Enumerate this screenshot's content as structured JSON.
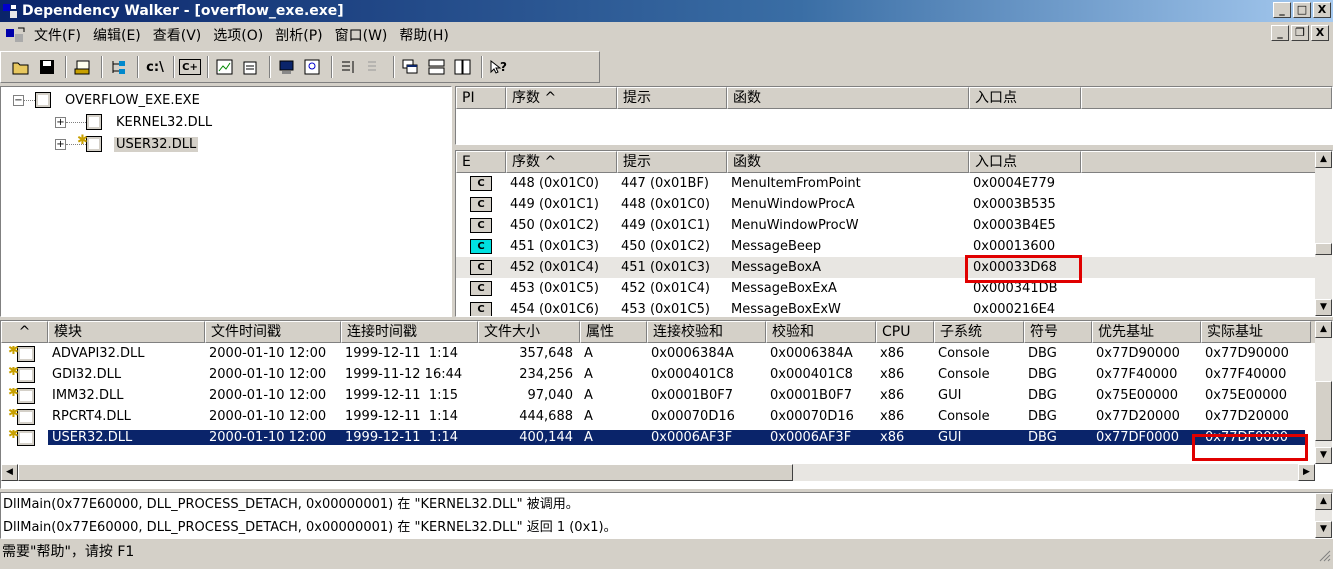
{
  "title": "Dependency Walker - [overflow_exe.exe]",
  "menu": [
    "文件(F)",
    "编辑(E)",
    "查看(V)",
    "选项(O)",
    "剖析(P)",
    "窗口(W)",
    "帮助(H)"
  ],
  "window_buttons": [
    "_",
    "□",
    "X"
  ],
  "mdi_buttons": [
    "_",
    "❐",
    "X"
  ],
  "toolbar": {
    "c_drive": "c:\\",
    "cpp": "C+"
  },
  "tree": [
    {
      "label": "OVERFLOW_EXE.EXE",
      "expander": "−",
      "warn": false
    },
    {
      "label": "KERNEL32.DLL",
      "expander": "+",
      "warn": false
    },
    {
      "label": "USER32.DLL",
      "expander": "+",
      "warn": true
    }
  ],
  "import_headers": [
    "PI",
    "序数 ^",
    "提示",
    "函数",
    "入口点"
  ],
  "export_headers": [
    "E",
    "序数 ^",
    "提示",
    "函数",
    "入口点"
  ],
  "exports": [
    {
      "type": "C",
      "ordinal": "448 (0x01C0)",
      "hint": "447 (0x01BF)",
      "func": "MenuItemFromPoint",
      "entry": "0x0004E779"
    },
    {
      "type": "C",
      "ordinal": "449 (0x01C1)",
      "hint": "448 (0x01C0)",
      "func": "MenuWindowProcA",
      "entry": "0x0003B535"
    },
    {
      "type": "C",
      "ordinal": "450 (0x01C2)",
      "hint": "449 (0x01C1)",
      "func": "MenuWindowProcW",
      "entry": "0x0003B4E5"
    },
    {
      "type": "C",
      "ordinal": "451 (0x01C3)",
      "hint": "450 (0x01C2)",
      "func": "MessageBeep",
      "entry": "0x00013600"
    },
    {
      "type": "C",
      "ordinal": "452 (0x01C4)",
      "hint": "451 (0x01C3)",
      "func": "MessageBoxA",
      "entry": "0x00033D68"
    },
    {
      "type": "C",
      "ordinal": "453 (0x01C5)",
      "hint": "452 (0x01C4)",
      "func": "MessageBoxExA",
      "entry": "0x000341DB"
    },
    {
      "type": "C",
      "ordinal": "454 (0x01C6)",
      "hint": "453 (0x01C5)",
      "func": "MessageBoxExW",
      "entry": "0x000216E4"
    }
  ],
  "module_headers": [
    "^",
    "模块",
    "文件时间戳",
    "连接时间戳",
    "文件大小",
    "属性",
    "连接校验和",
    "校验和",
    "CPU",
    "子系统",
    "符号",
    "优先基址",
    "实际基址"
  ],
  "modules": [
    {
      "name": "ADVAPI32.DLL",
      "filetime": "2000-01-10 12:00",
      "linktime": "1999-12-11  1:14",
      "size": "357,648",
      "attr": "A",
      "linkcs": "0x0006384A",
      "cs": "0x0006384A",
      "cpu": "x86",
      "subsys": "Console",
      "sym": "DBG",
      "pref": "0x77D90000",
      "actual": "0x77D90000"
    },
    {
      "name": "GDI32.DLL",
      "filetime": "2000-01-10 12:00",
      "linktime": "1999-11-12 16:44",
      "size": "234,256",
      "attr": "A",
      "linkcs": "0x000401C8",
      "cs": "0x000401C8",
      "cpu": "x86",
      "subsys": "Console",
      "sym": "DBG",
      "pref": "0x77F40000",
      "actual": "0x77F40000"
    },
    {
      "name": "IMM32.DLL",
      "filetime": "2000-01-10 12:00",
      "linktime": "1999-12-11  1:15",
      "size": "97,040",
      "attr": "A",
      "linkcs": "0x0001B0F7",
      "cs": "0x0001B0F7",
      "cpu": "x86",
      "subsys": "GUI",
      "sym": "DBG",
      "pref": "0x75E00000",
      "actual": "0x75E00000"
    },
    {
      "name": "RPCRT4.DLL",
      "filetime": "2000-01-10 12:00",
      "linktime": "1999-12-11  1:14",
      "size": "444,688",
      "attr": "A",
      "linkcs": "0x00070D16",
      "cs": "0x00070D16",
      "cpu": "x86",
      "subsys": "Console",
      "sym": "DBG",
      "pref": "0x77D20000",
      "actual": "0x77D20000"
    },
    {
      "name": "USER32.DLL",
      "filetime": "2000-01-10 12:00",
      "linktime": "1999-12-11  1:14",
      "size": "400,144",
      "attr": "A",
      "linkcs": "0x0006AF3F",
      "cs": "0x0006AF3F",
      "cpu": "x86",
      "subsys": "GUI",
      "sym": "DBG",
      "pref": "0x77DF0000",
      "actual": "0x77DF0000"
    }
  ],
  "log": [
    "DllMain(0x77E60000, DLL_PROCESS_DETACH, 0x00000001) 在 \"KERNEL32.DLL\" 被调用。",
    "DllMain(0x77E60000, DLL_PROCESS_DETACH, 0x00000001) 在 \"KERNEL32.DLL\" 返回 1 (0x1)。"
  ],
  "status": "需要\"帮助\"，请按 F1",
  "colors": {
    "highlight": "#e00000",
    "selection": "#0a246a"
  }
}
